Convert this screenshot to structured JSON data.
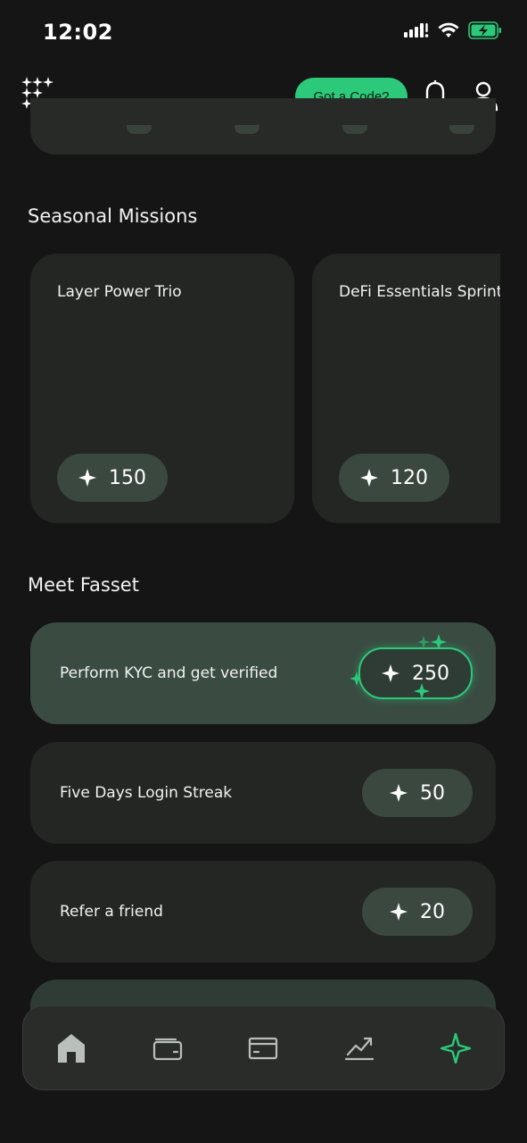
{
  "status_bar": {
    "time": "12:02",
    "icons": [
      "signal-icon",
      "wifi-icon",
      "battery-charging-icon"
    ]
  },
  "header": {
    "logo": "fasset-logo-icon",
    "code_button_label": "Got a Code?",
    "icons": [
      "bell-icon",
      "user-icon"
    ]
  },
  "seasonal": {
    "title": "Seasonal Missions",
    "cards": [
      {
        "title": "Layer Power Trio",
        "points": "150"
      },
      {
        "title": "DeFi Essentials Sprint",
        "points": "120"
      }
    ]
  },
  "meet": {
    "title": "Meet Fasset",
    "rows": [
      {
        "label": "Perform KYC and get verified",
        "points": "250",
        "active": true
      },
      {
        "label": "Five Days Login Streak",
        "points": "50",
        "active": false
      },
      {
        "label": "Refer a friend",
        "points": "20",
        "active": false
      }
    ]
  },
  "bottom_nav": {
    "items": [
      "home-icon",
      "wallet-icon",
      "card-icon",
      "chart-icon",
      "rewards-sparkle-icon"
    ],
    "active": "rewards-sparkle-icon"
  },
  "colors": {
    "background": "#141514",
    "card": "#232623",
    "card_active": "#3a4b42",
    "pill": "#3a4840",
    "accent": "#2cc97a"
  }
}
